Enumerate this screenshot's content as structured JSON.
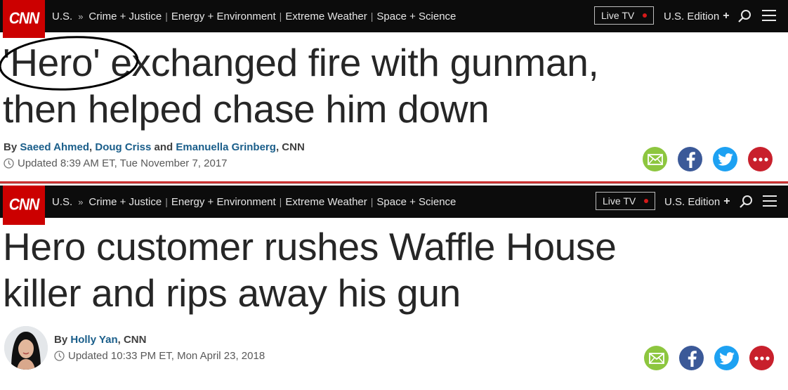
{
  "logo": "CNN",
  "nav": {
    "section": "U.S.",
    "chevron": "»",
    "links": [
      "Crime + Justice",
      "Energy + Environment",
      "Extreme Weather",
      "Space + Science"
    ],
    "separator": "|",
    "live_tv": "Live TV",
    "edition": "U.S. Edition",
    "edition_plus": "+"
  },
  "article1": {
    "headline_line1": "'Hero' exchanged fire with gunman,",
    "headline_line2": "then helped chase him down",
    "by": "By",
    "author1": "Saeed Ahmed",
    "comma1": ",",
    "author2": "Doug Criss",
    "and": "and",
    "author3": "Emanuella Grinberg",
    "source": ", CNN",
    "updated": "Updated 8:39 AM ET, Tue November 7, 2017"
  },
  "article2": {
    "headline_line1": "Hero customer rushes Waffle House",
    "headline_line2": "killer and rips away his gun",
    "by": "By",
    "author": "Holly Yan",
    "source": ", CNN",
    "updated": "Updated 10:33 PM ET, Mon April 23, 2018"
  },
  "colors": {
    "cnn_red": "#cc0000",
    "navbar": "#0c0c0c",
    "link_blue": "#1a5e8a",
    "email_green": "#8dc63f",
    "facebook_blue": "#3b5998",
    "twitter_blue": "#1da1f2",
    "more_red": "#c8202c"
  },
  "icons": [
    "search-icon",
    "menu-icon",
    "clock-icon",
    "email-icon",
    "facebook-icon",
    "twitter-icon",
    "more-icon"
  ]
}
